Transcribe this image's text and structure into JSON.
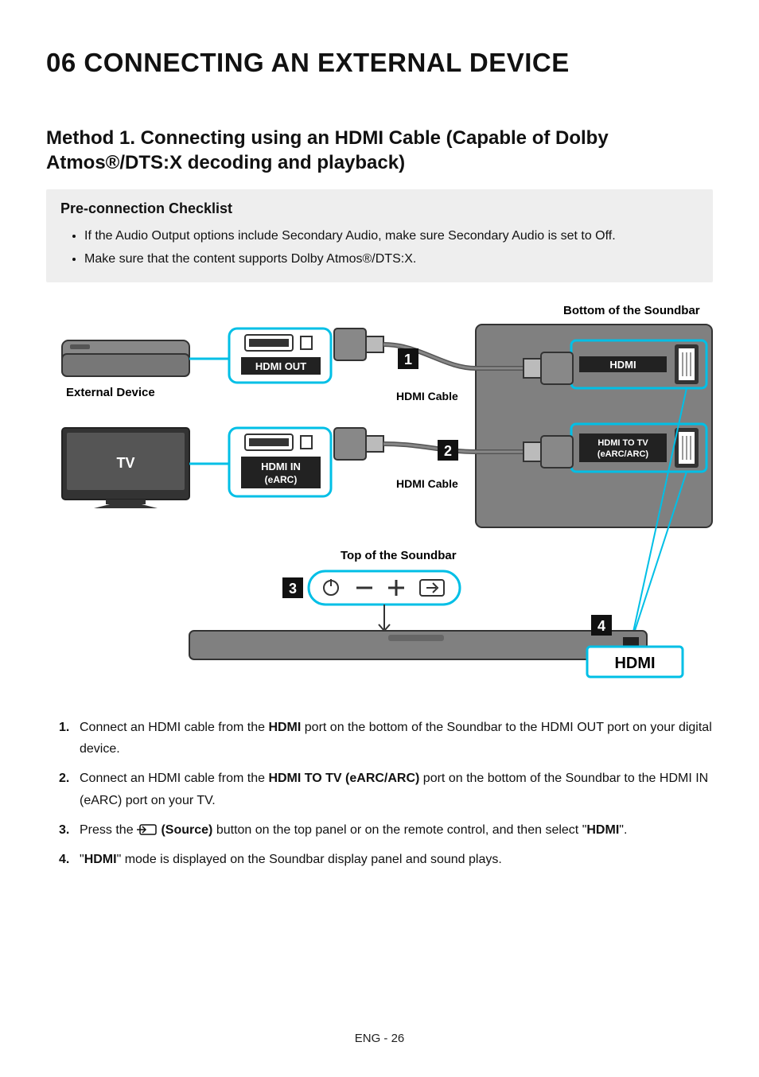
{
  "title": "06   CONNECTING AN EXTERNAL DEVICE",
  "method_title": "Method 1. Connecting using an HDMI Cable (Capable of Dolby Atmos®/DTS:X decoding and playback)",
  "checklist": {
    "heading": "Pre-connection Checklist",
    "items": [
      "If the Audio Output options include Secondary Audio, make sure Secondary Audio is set to Off.",
      "Make sure that the content supports Dolby Atmos®/DTS:X."
    ]
  },
  "diagram": {
    "bottom_label": "Bottom of the Soundbar",
    "top_label": "Top of the Soundbar",
    "external_device": "External Device",
    "tv": "TV",
    "hdmi_out": "HDMI OUT",
    "hdmi_in": "HDMI IN\n(eARC)",
    "hdmi_in_l1": "HDMI IN",
    "hdmi_in_l2": "(eARC)",
    "hdmi_cable": "HDMI Cable",
    "soundbar_hdmi": "HDMI",
    "soundbar_hdmi_to_tv_l1": "HDMI TO TV",
    "soundbar_hdmi_to_tv_l2": "(eARC/ARC)",
    "display_hdmi": "HDMI",
    "step1": "1",
    "step2": "2",
    "step3": "3",
    "step4": "4"
  },
  "steps": [
    {
      "n": "1.",
      "pre": "Connect an HDMI cable from the ",
      "b1": "HDMI",
      "mid": " port on the bottom of the Soundbar to the HDMI OUT port on your digital device.",
      "b2": "",
      "post": ""
    },
    {
      "n": "2.",
      "pre": "Connect an HDMI cable from the ",
      "b1": "HDMI TO TV (eARC/ARC)",
      "mid": " port on the bottom of the Soundbar to the HDMI IN (eARC) port on your TV.",
      "b2": "",
      "post": ""
    },
    {
      "n": "3.",
      "pre": "Press the ",
      "icon": true,
      "b1": " (Source)",
      "mid": " button on the top panel or on the remote control, and then select \"",
      "b2": "HDMI",
      "post": "\"."
    },
    {
      "n": "4.",
      "pre": "\"",
      "b1": "HDMI",
      "mid": "\" mode is displayed on the Soundbar display panel and sound plays.",
      "b2": "",
      "post": ""
    }
  ],
  "footer": "ENG - 26"
}
